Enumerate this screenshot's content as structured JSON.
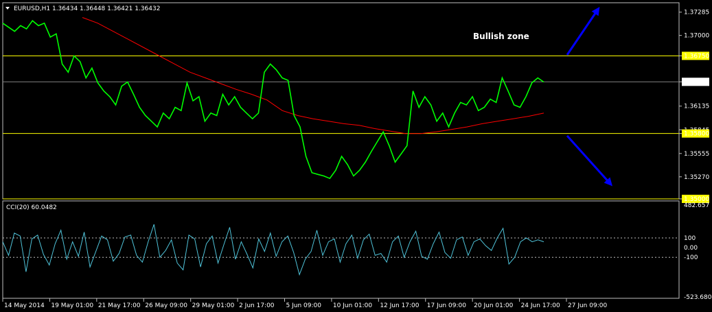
{
  "colors": {
    "background": "#000000",
    "price_line": "#00ff00",
    "ma_line": "#ff0000",
    "cci_line": "#4fc3d9",
    "level_line": "#ffff00",
    "arrow": "#0000ff",
    "text": "#ffffff",
    "grid_frame": "#c0c0c0"
  },
  "chart_data": [
    {
      "type": "line",
      "header": "EURUSD,H1  1.36434 1.36448 1.36421 1.36432",
      "annotation": "Bullish zone",
      "x_labels": [
        "14 May 2014",
        "19 May 01:00",
        "21 May 17:00",
        "26 May 09:00",
        "29 May 01:00",
        "2 Jun 17:00",
        "5 Jun 09:00",
        "10 Jun 01:00",
        "12 Jun 17:00",
        "17 Jun 09:00",
        "20 Jun 01:00",
        "24 Jun 17:00",
        "27 Jun 09:00"
      ],
      "y_ticks": [
        "1.37285",
        "1.37000",
        "1.36750",
        "1.36432",
        "1.36135",
        "1.35845",
        "1.35800",
        "1.35555",
        "1.35270",
        "1.35000"
      ],
      "ylim": [
        1.35,
        1.374
      ],
      "horizontal_levels": [
        1.3675,
        1.358,
        1.35
      ],
      "current_price": 1.36432,
      "series": [
        {
          "values": [
            1.3715,
            1.371,
            1.3705,
            1.3712,
            1.3708,
            1.3718,
            1.3712,
            1.3715,
            1.3698,
            1.3702,
            1.3665,
            1.3655,
            1.3675,
            1.3668,
            1.3648,
            1.366,
            1.3642,
            1.3632,
            1.3625,
            1.3615,
            1.3638,
            1.3643,
            1.3628,
            1.3612,
            1.3602,
            1.3595,
            1.3588,
            1.3605,
            1.3598,
            1.3612,
            1.3608,
            1.3642,
            1.362,
            1.3625,
            1.3595,
            1.3605,
            1.3602,
            1.3628,
            1.3615,
            1.3625,
            1.3612,
            1.3605,
            1.3598,
            1.3605,
            1.3655,
            1.3665,
            1.3658,
            1.3648,
            1.3645,
            1.3602,
            1.3588,
            1.3552,
            1.3532,
            1.353,
            1.3528,
            1.3525,
            1.3535,
            1.3552,
            1.3542,
            1.3528,
            1.3535,
            1.3545,
            1.3558,
            1.357,
            1.3582,
            1.3565,
            1.3545,
            1.3555,
            1.3565,
            1.3632,
            1.3612,
            1.3625,
            1.3615,
            1.3595,
            1.3605,
            1.3588,
            1.3605,
            1.3618,
            1.3615,
            1.3625,
            1.3608,
            1.3612,
            1.3622,
            1.3618,
            1.3648,
            1.3632,
            1.3615,
            1.3612,
            1.3625,
            1.3642,
            1.3648,
            1.3643
          ]
        },
        {
          "values": [
            1.3722,
            1.3715,
            1.3705,
            1.3695,
            1.3685,
            1.3675,
            1.3665,
            1.3655,
            1.3648,
            1.3641,
            1.3634,
            1.3628,
            1.3621,
            1.3608,
            1.3602,
            1.3598,
            1.3595,
            1.3592,
            1.359,
            1.3586,
            1.3583,
            1.358,
            1.358,
            1.3582,
            1.3585,
            1.3588,
            1.3592,
            1.3595,
            1.3598,
            1.3601,
            1.3605
          ]
        }
      ]
    },
    {
      "type": "line",
      "title": "CCI(20) 60.0482",
      "y_ticks": [
        "482.657",
        "100",
        "0.00",
        "-100",
        "-523.6804"
      ],
      "ylim": [
        -523.6804,
        482.657
      ],
      "levels": [
        100,
        -100
      ],
      "series": [
        {
          "values": [
            60,
            -80,
            150,
            120,
            -250,
            90,
            130,
            -70,
            -180,
            40,
            180,
            -120,
            60,
            -90,
            160,
            -200,
            -40,
            120,
            80,
            -140,
            -60,
            110,
            130,
            -80,
            -150,
            60,
            240,
            -100,
            -30,
            80,
            -160,
            -230,
            130,
            90,
            -200,
            40,
            120,
            -160,
            30,
            210,
            -120,
            60,
            -70,
            -210,
            90,
            -40,
            150,
            -90,
            60,
            120,
            -50,
            -280,
            -120,
            -40,
            180,
            -80,
            60,
            90,
            -150,
            40,
            130,
            -110,
            80,
            140,
            -80,
            -60,
            -150,
            60,
            120,
            -100,
            60,
            170,
            -90,
            -120,
            40,
            160,
            -50,
            -110,
            80,
            110,
            -80,
            60,
            90,
            20,
            -30,
            100,
            200,
            -170,
            -100,
            60,
            100,
            60,
            80,
            60
          ]
        }
      ]
    }
  ]
}
